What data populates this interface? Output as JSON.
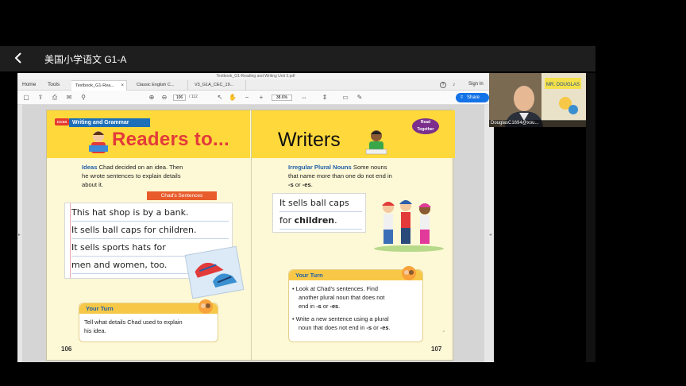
{
  "app": {
    "title": "美国小学语文 G1-A"
  },
  "viewer": {
    "window_title": "Textbook_G1-Reading and Writing Unit 3.pdf",
    "nav": {
      "home": "Home",
      "tools": "Tools"
    },
    "tabs": [
      {
        "label": "Textbook_G1-Rea...",
        "close": "×"
      },
      {
        "label": "Classic English C..."
      },
      {
        "label": "V3_G1A_CEC_19..."
      }
    ],
    "sign_in": "Sign In",
    "page_current": "106",
    "page_total": "/ 112",
    "zoom": "38.6%",
    "share": "Share"
  },
  "left_page": {
    "ccss": "CCSS",
    "banner": "Writing and Grammar",
    "title": "Readers to...",
    "ideas_label": "Ideas",
    "ideas_line1": "Chad decided on an idea. Then",
    "ideas_line2": "he wrote sentences to explain details",
    "ideas_line3": "about it.",
    "chads_sentences": "Chad's Sentences",
    "lines": [
      "This hat shop is by a bank.",
      "It sells ball caps for children.",
      "It sells sports hats for",
      "men and women, too."
    ],
    "your_turn": "Your Turn",
    "yt_line1": "Tell what details Chad used to explain",
    "yt_line2": "his idea.",
    "page_number": "106"
  },
  "right_page": {
    "title": "Writers",
    "read_together": "Read Together",
    "ipn_label": "Irregular Plural Nouns",
    "ipn_line1": "Some nouns",
    "ipn_line2": "that name more than one do not end in",
    "ipn_s": "-s",
    "ipn_or": "or",
    "ipn_es": "-es",
    "example_line1": "It sells ball caps",
    "example_for": "for",
    "example_children": "children",
    "your_turn": "Your Turn",
    "b1_line1": "Look at Chad's sentences. Find",
    "b1_line2": "another plural noun that does not",
    "b1_line3_pre": "end in",
    "b1_s": "-s",
    "b1_or": "or",
    "b1_es": "-es",
    "b2_line1": "Write a new sentence using a plural",
    "b2_line2_pre": "noun that does not end in",
    "b2_s": "-s",
    "b2_or": "or",
    "b2_es": "-es",
    "page_number": "107"
  },
  "video": {
    "name": "DouglasC1694@xou...",
    "sign": "MR. DOUGLAS"
  },
  "colors": {
    "accent": "#1473e6",
    "band": "#ffd93b",
    "title_red": "#e23a3a"
  }
}
